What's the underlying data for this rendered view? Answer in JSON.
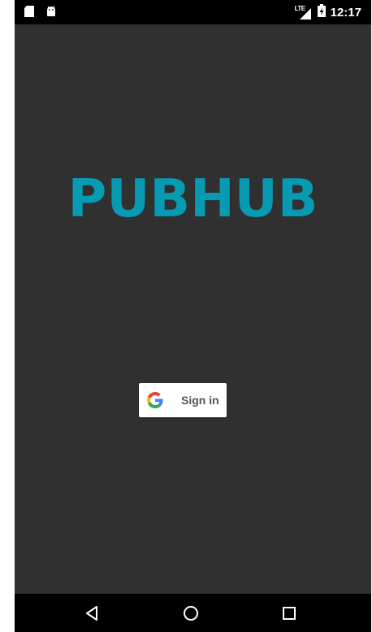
{
  "status_bar": {
    "left_icons": [
      "sd-card-icon",
      "android-icon"
    ],
    "network_label": "LTE",
    "battery_icon": "battery-charging-icon",
    "time": "12:17"
  },
  "app": {
    "logo_text": "PUBHUB",
    "logo_color": "#079ab3",
    "background_color": "#303030"
  },
  "signin": {
    "icon": "google-icon",
    "label": "Sign in"
  },
  "nav_bar": {
    "buttons": [
      "back-icon",
      "home-icon",
      "recents-icon"
    ]
  }
}
